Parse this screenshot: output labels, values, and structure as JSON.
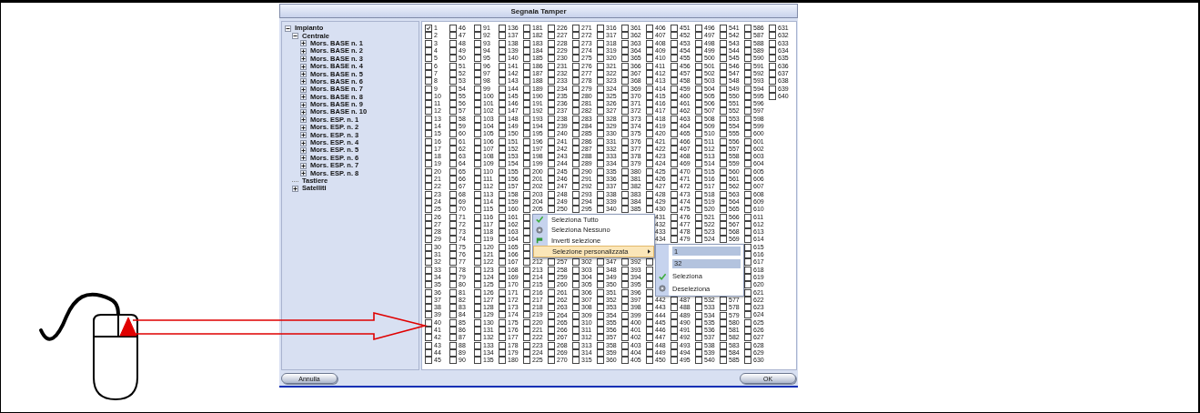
{
  "dialog": {
    "title": "Segnala Tamper",
    "tree": [
      {
        "label": "Impianto",
        "kind": "node",
        "expanded": true,
        "children": [
          {
            "label": "Centrale",
            "kind": "node",
            "expanded": true,
            "children": [
              {
                "label": "Mors. BASE n. 1",
                "kind": "node",
                "expanded": false
              },
              {
                "label": "Mors. BASE n. 2",
                "kind": "node",
                "expanded": false
              },
              {
                "label": "Mors. BASE n. 3",
                "kind": "node",
                "expanded": false
              },
              {
                "label": "Mors. BASE n. 4",
                "kind": "node",
                "expanded": false
              },
              {
                "label": "Mors. BASE n. 5",
                "kind": "node",
                "expanded": false
              },
              {
                "label": "Mors. BASE n. 6",
                "kind": "node",
                "expanded": false
              },
              {
                "label": "Mors. BASE n. 7",
                "kind": "node",
                "expanded": false
              },
              {
                "label": "Mors. BASE n. 8",
                "kind": "node",
                "expanded": false
              },
              {
                "label": "Mors. BASE n. 9",
                "kind": "node",
                "expanded": false
              },
              {
                "label": "Mors. BASE n. 10",
                "kind": "node",
                "expanded": false
              },
              {
                "label": "Mors. ESP. n. 1",
                "kind": "node",
                "expanded": false
              },
              {
                "label": "Mors. ESP. n. 2",
                "kind": "node",
                "expanded": false
              },
              {
                "label": "Mors. ESP. n. 3",
                "kind": "node",
                "expanded": false
              },
              {
                "label": "Mors. ESP. n. 4",
                "kind": "node",
                "expanded": false
              },
              {
                "label": "Mors. ESP. n. 5",
                "kind": "node",
                "expanded": false
              },
              {
                "label": "Mors. ESP. n. 6",
                "kind": "node",
                "expanded": false
              },
              {
                "label": "Mors. ESP. n. 7",
                "kind": "node",
                "expanded": false
              },
              {
                "label": "Mors. ESP. n. 8",
                "kind": "node",
                "expanded": false
              }
            ]
          },
          {
            "label": "Tastiere",
            "kind": "leaf"
          },
          {
            "label": "Satelliti",
            "kind": "node",
            "expanded": false
          }
        ]
      }
    ],
    "grid": {
      "columns": [
        {
          "segments": [
            {
              "kind": "full",
              "numbers": [
                "1",
                "2",
                "3",
                "4",
                "5",
                "6",
                "7",
                "8",
                "9",
                "10",
                "11",
                "12",
                "13",
                "14",
                "15",
                "16",
                "17",
                "18",
                "19",
                "20",
                "21",
                "22",
                "23",
                "24",
                "25",
                "26",
                "27",
                "28",
                "29",
                "30",
                "31",
                "32",
                "33",
                "34",
                "35",
                "36",
                "37",
                "38",
                "39",
                "40",
                "41",
                "42",
                "43",
                "44",
                "45"
              ],
              "checked": [
                true,
                false,
                false,
                false,
                false,
                false,
                false,
                false,
                false,
                false,
                false,
                false,
                false,
                false,
                false,
                false,
                false,
                false,
                false,
                false,
                false,
                false,
                false,
                false,
                false,
                false,
                false,
                false,
                false,
                false,
                false,
                false,
                false,
                false,
                false,
                false,
                false,
                false,
                false,
                false,
                false,
                false,
                false,
                false,
                false
              ]
            }
          ]
        },
        {
          "segments": [
            {
              "kind": "full",
              "numbers": [
                "46",
                "47",
                "48",
                "49",
                "50",
                "51",
                "52",
                "53",
                "54",
                "55",
                "56",
                "57",
                "58",
                "59",
                "60",
                "61",
                "62",
                "63",
                "64",
                "65",
                "66",
                "67",
                "68",
                "69",
                "70",
                "71",
                "72",
                "73",
                "74",
                "75",
                "76",
                "77",
                "78",
                "79",
                "80",
                "81",
                "82",
                "83",
                "84",
                "85",
                "86",
                "87",
                "88",
                "89",
                "90"
              ],
              "checked": [
                false,
                false,
                false,
                false,
                false,
                false,
                false,
                false,
                false,
                false,
                false,
                false,
                false,
                false,
                false,
                false,
                false,
                false,
                false,
                false,
                false,
                false,
                false,
                false,
                false,
                false,
                false,
                false,
                false,
                false,
                false,
                false,
                false,
                false,
                false,
                false,
                false,
                false,
                false,
                false,
                false,
                false,
                false,
                false,
                false
              ]
            }
          ]
        },
        {
          "segments": [
            {
              "kind": "full",
              "numbers": [
                "91",
                "92",
                "93",
                "94",
                "95",
                "96",
                "97",
                "98",
                "99",
                "100",
                "101",
                "102",
                "103",
                "104",
                "105",
                "106",
                "107",
                "108",
                "109",
                "110",
                "111",
                "112",
                "113",
                "114",
                "115",
                "116",
                "117",
                "118",
                "119",
                "120",
                "121",
                "122",
                "123",
                "124",
                "125",
                "126",
                "127",
                "128",
                "129",
                "130",
                "131",
                "132",
                "133",
                "134",
                "135"
              ],
              "checked": [
                false,
                false,
                false,
                false,
                false,
                false,
                false,
                false,
                false,
                false,
                false,
                false,
                false,
                false,
                false,
                false,
                false,
                false,
                false,
                false,
                false,
                false,
                false,
                false,
                false,
                false,
                false,
                false,
                false,
                false,
                false,
                false,
                false,
                false,
                false,
                false,
                false,
                false,
                false,
                false,
                false,
                false,
                false,
                false,
                false
              ]
            }
          ]
        },
        {
          "segments": [
            {
              "kind": "full",
              "numbers": [
                "136",
                "137",
                "138",
                "139",
                "140",
                "141",
                "142",
                "143",
                "144",
                "145",
                "146",
                "147",
                "148",
                "149",
                "150",
                "151",
                "152",
                "153",
                "154",
                "155",
                "156",
                "157",
                "158",
                "159",
                "160",
                "161",
                "162",
                "163",
                "164",
                "165",
                "166",
                "167",
                "168",
                "169",
                "170",
                "171",
                "172",
                "173",
                "174",
                "175",
                "176",
                "177",
                "178",
                "179",
                "180"
              ],
              "checked": [
                false,
                false,
                false,
                false,
                false,
                false,
                false,
                false,
                false,
                false,
                false,
                false,
                false,
                false,
                false,
                false,
                false,
                false,
                false,
                false,
                false,
                false,
                false,
                false,
                false,
                false,
                false,
                false,
                false,
                false,
                false,
                false,
                false,
                false,
                false,
                false,
                false,
                false,
                false,
                false,
                false,
                false,
                false,
                false,
                false
              ]
            }
          ]
        },
        {
          "segments": [
            {
              "kind": "full",
              "numbers": [
                "181",
                "182",
                "183",
                "184",
                "185",
                "186",
                "187",
                "188",
                "189",
                "190",
                "191",
                "192",
                "193",
                "194",
                "195",
                "196",
                "197",
                "198",
                "199",
                "200",
                "201",
                "202",
                "203",
                "204",
                "205"
              ],
              "checked": [
                false,
                false,
                false,
                false,
                false,
                false,
                false,
                false,
                false,
                false,
                false,
                false,
                false,
                false,
                false,
                false,
                false,
                false,
                false,
                false,
                false,
                false,
                false,
                false,
                false
              ]
            },
            {
              "kind": "boxes",
              "checked": [
                false,
                false,
                false,
                false,
                false,
                false
              ]
            },
            {
              "kind": "full",
              "numbers": [
                "212",
                "213",
                "214",
                "215",
                "216",
                "217",
                "218",
                "219",
                "220",
                "221",
                "222",
                "223",
                "224",
                "225"
              ],
              "checked": [
                false,
                false,
                false,
                false,
                false,
                false,
                false,
                false,
                false,
                false,
                false,
                false,
                false,
                false
              ]
            }
          ]
        },
        {
          "segments": [
            {
              "kind": "full",
              "numbers": [
                "226",
                "227",
                "228",
                "229",
                "230",
                "231",
                "232",
                "233",
                "234",
                "235",
                "236",
                "237",
                "238",
                "239",
                "240",
                "241",
                "242",
                "243",
                "244",
                "245",
                "246",
                "247",
                "248",
                "249",
                "250"
              ],
              "checked": [
                false,
                false,
                false,
                false,
                false,
                false,
                false,
                false,
                false,
                false,
                false,
                false,
                false,
                false,
                false,
                false,
                false,
                false,
                false,
                false,
                false,
                false,
                false,
                false,
                false
              ]
            },
            {
              "kind": "gap"
            },
            {
              "kind": "full",
              "numbers": [
                "257",
                "258",
                "259",
                "260",
                "261",
                "262",
                "263",
                "264",
                "265",
                "266",
                "267",
                "268",
                "269",
                "270"
              ],
              "checked": [
                false,
                false,
                false,
                false,
                false,
                false,
                false,
                false,
                false,
                false,
                false,
                false,
                false,
                false
              ]
            }
          ]
        },
        {
          "segments": [
            {
              "kind": "full",
              "numbers": [
                "271",
                "272",
                "273",
                "274",
                "275",
                "276",
                "277",
                "278",
                "279",
                "280",
                "281",
                "282",
                "283",
                "284",
                "285",
                "286",
                "287",
                "288",
                "289",
                "290",
                "291",
                "292",
                "293",
                "294",
                "295"
              ],
              "checked": [
                false,
                false,
                false,
                false,
                false,
                false,
                false,
                false,
                false,
                false,
                false,
                false,
                false,
                false,
                false,
                false,
                false,
                false,
                false,
                false,
                false,
                false,
                false,
                false,
                false
              ]
            },
            {
              "kind": "gap"
            },
            {
              "kind": "full",
              "numbers": [
                "302",
                "303",
                "304",
                "305",
                "306",
                "307",
                "308",
                "309",
                "310",
                "311",
                "312",
                "313",
                "314",
                "315"
              ],
              "checked": [
                false,
                false,
                false,
                false,
                false,
                false,
                false,
                false,
                false,
                false,
                false,
                false,
                false,
                false
              ]
            }
          ]
        },
        {
          "segments": [
            {
              "kind": "full",
              "numbers": [
                "316",
                "317",
                "318",
                "319",
                "320",
                "321",
                "322",
                "323",
                "324",
                "325",
                "326",
                "327",
                "328",
                "329",
                "330",
                "331",
                "332",
                "333",
                "334",
                "335",
                "336",
                "337",
                "338",
                "339",
                "340"
              ],
              "checked": [
                false,
                false,
                false,
                false,
                false,
                false,
                false,
                false,
                false,
                false,
                false,
                false,
                false,
                false,
                false,
                false,
                false,
                false,
                false,
                false,
                false,
                false,
                false,
                false,
                false
              ]
            },
            {
              "kind": "gap"
            },
            {
              "kind": "full",
              "numbers": [
                "347",
                "348",
                "349",
                "350",
                "351",
                "352",
                "353",
                "354",
                "355",
                "356",
                "357",
                "358",
                "359",
                "360"
              ],
              "checked": [
                false,
                false,
                false,
                false,
                false,
                false,
                false,
                false,
                false,
                false,
                false,
                false,
                false,
                false
              ]
            }
          ]
        },
        {
          "segments": [
            {
              "kind": "full",
              "numbers": [
                "361",
                "362",
                "363",
                "364",
                "365",
                "366",
                "367",
                "368",
                "369",
                "370",
                "371",
                "372",
                "373",
                "374",
                "375",
                "376",
                "377",
                "378",
                "379",
                "380",
                "381",
                "382",
                "383",
                "384",
                "385"
              ],
              "checked": [
                false,
                false,
                false,
                false,
                false,
                false,
                false,
                false,
                false,
                false,
                false,
                false,
                false,
                false,
                false,
                false,
                false,
                false,
                false,
                false,
                false,
                false,
                false,
                false,
                false
              ]
            },
            {
              "kind": "gap"
            },
            {
              "kind": "full",
              "numbers": [
                "392",
                "393",
                "394",
                "395",
                "396",
                "397",
                "398",
                "399",
                "400",
                "401",
                "402",
                "403",
                "404",
                "405"
              ],
              "checked": [
                false,
                false,
                false,
                false,
                false,
                false,
                false,
                false,
                false,
                false,
                false,
                false,
                false,
                false
              ]
            }
          ]
        },
        {
          "segments": [
            {
              "kind": "full",
              "numbers": [
                "406",
                "407",
                "408",
                "409",
                "410",
                "411",
                "412",
                "413",
                "414",
                "415",
                "416",
                "417",
                "418",
                "419",
                "420",
                "421",
                "422",
                "423",
                "424",
                "425",
                "426",
                "427",
                "428",
                "429",
                "430"
              ],
              "checked": [
                false,
                false,
                false,
                false,
                false,
                false,
                false,
                false,
                false,
                false,
                false,
                false,
                false,
                false,
                false,
                false,
                false,
                false,
                false,
                false,
                false,
                false,
                false,
                false,
                false
              ]
            },
            {
              "kind": "labels",
              "numbers": [
                "431",
                "432",
                "433",
                "434"
              ]
            },
            {
              "kind": "gap"
            },
            {
              "kind": "boxes",
              "checked": [
                false,
                false,
                false,
                false,
                false
              ]
            },
            {
              "kind": "full",
              "numbers": [
                "442",
                "443",
                "444",
                "445",
                "446",
                "447",
                "448",
                "449",
                "450"
              ],
              "checked": [
                false,
                false,
                false,
                false,
                false,
                false,
                false,
                false,
                false
              ]
            }
          ]
        },
        {
          "segments": [
            {
              "kind": "full",
              "numbers": [
                "451",
                "452",
                "453",
                "454",
                "455",
                "456",
                "457",
                "458",
                "459",
                "460",
                "461",
                "462",
                "463",
                "464",
                "465",
                "466",
                "467",
                "468",
                "469",
                "470",
                "471",
                "472",
                "473",
                "474",
                "475",
                "476",
                "477",
                "478",
                "479"
              ],
              "checked": [
                false,
                false,
                false,
                false,
                false,
                false,
                false,
                false,
                false,
                false,
                false,
                false,
                false,
                false,
                false,
                false,
                false,
                false,
                false,
                false,
                false,
                false,
                false,
                false,
                false,
                false,
                false,
                false,
                false
              ]
            },
            {
              "kind": "gap"
            },
            {
              "kind": "full",
              "numbers": [
                "487",
                "488",
                "489",
                "490",
                "491",
                "492",
                "493",
                "494",
                "495"
              ],
              "checked": [
                false,
                false,
                false,
                false,
                false,
                false,
                false,
                false,
                false
              ]
            }
          ]
        },
        {
          "segments": [
            {
              "kind": "full",
              "numbers": [
                "496",
                "497",
                "498",
                "499",
                "500",
                "501",
                "502",
                "503",
                "504",
                "505",
                "506",
                "507",
                "508",
                "509",
                "510",
                "511",
                "512",
                "513",
                "514",
                "515",
                "516",
                "517",
                "518",
                "519",
                "520",
                "521",
                "522",
                "523",
                "524"
              ],
              "checked": [
                false,
                false,
                false,
                false,
                false,
                false,
                false,
                false,
                false,
                false,
                false,
                false,
                false,
                false,
                false,
                false,
                false,
                false,
                false,
                false,
                false,
                false,
                false,
                false,
                false,
                false,
                false,
                false,
                false
              ]
            },
            {
              "kind": "gap"
            },
            {
              "kind": "full",
              "numbers": [
                "532",
                "533",
                "534",
                "535",
                "536",
                "537",
                "538",
                "539",
                "540"
              ],
              "checked": [
                false,
                false,
                false,
                false,
                false,
                false,
                false,
                false,
                false
              ]
            }
          ]
        },
        {
          "segments": [
            {
              "kind": "full",
              "numbers": [
                "541",
                "542",
                "543",
                "544",
                "545",
                "546",
                "547",
                "548",
                "549",
                "550",
                "551",
                "552",
                "553",
                "554",
                "555",
                "556",
                "557",
                "558",
                "559",
                "560",
                "561",
                "562",
                "563",
                "564",
                "565",
                "566",
                "567",
                "568",
                "569"
              ],
              "checked": [
                false,
                false,
                false,
                false,
                false,
                false,
                false,
                false,
                false,
                false,
                false,
                false,
                false,
                false,
                false,
                false,
                false,
                false,
                false,
                false,
                false,
                false,
                false,
                false,
                false,
                false,
                false,
                false,
                false
              ]
            },
            {
              "kind": "gap"
            },
            {
              "kind": "full",
              "numbers": [
                "577",
                "578",
                "579",
                "580",
                "581",
                "582",
                "583",
                "584",
                "585"
              ],
              "checked": [
                false,
                false,
                false,
                false,
                false,
                false,
                false,
                false,
                false
              ]
            }
          ]
        },
        {
          "segments": [
            {
              "kind": "full",
              "numbers": [
                "586",
                "587",
                "588",
                "589",
                "590",
                "591",
                "592",
                "593",
                "594",
                "595",
                "596",
                "597",
                "598",
                "599",
                "600",
                "601",
                "602",
                "603",
                "604",
                "605",
                "606",
                "607",
                "608",
                "609",
                "610",
                "611",
                "612",
                "613",
                "614",
                "615",
                "616",
                "617",
                "618",
                "619",
                "620",
                "621",
                "622",
                "623",
                "624",
                "625",
                "626",
                "627",
                "628",
                "629",
                "630"
              ],
              "checked": [
                false,
                false,
                false,
                false,
                false,
                false,
                false,
                false,
                false,
                false,
                false,
                false,
                false,
                false,
                false,
                false,
                false,
                false,
                false,
                false,
                false,
                false,
                false,
                false,
                false,
                false,
                false,
                false,
                false,
                false,
                false,
                false,
                false,
                false,
                false,
                false,
                false,
                false,
                false,
                false,
                false,
                false,
                false,
                false,
                false
              ]
            }
          ]
        },
        {
          "segments": [
            {
              "kind": "full",
              "numbers": [
                "631",
                "632",
                "633",
                "634",
                "635",
                "636",
                "637",
                "638",
                "639",
                "640"
              ],
              "checked": [
                false,
                false,
                false,
                false,
                false,
                false,
                false,
                false,
                false,
                false
              ]
            }
          ]
        }
      ]
    },
    "context_menu": {
      "items": [
        {
          "label": "Seleziona Tutto",
          "kind": "select-all",
          "selected": false
        },
        {
          "label": "Seleziona Nessuno",
          "kind": "select-none",
          "selected": false
        },
        {
          "label": "Inverti selezione",
          "kind": "invert",
          "selected": false
        },
        {
          "label": "Selezione personalizzata",
          "kind": "submenu",
          "selected": true
        }
      ],
      "submenu": {
        "fields": [
          {
            "value": "1"
          },
          {
            "value": "32"
          }
        ],
        "items": [
          {
            "label": "Seleziona",
            "kind": "select-all"
          },
          {
            "label": "Deseleziona",
            "kind": "select-none"
          }
        ]
      }
    },
    "buttons": [
      {
        "label": "Annulla",
        "kind": "cancel"
      },
      {
        "label": "OK",
        "kind": "ok"
      }
    ]
  }
}
